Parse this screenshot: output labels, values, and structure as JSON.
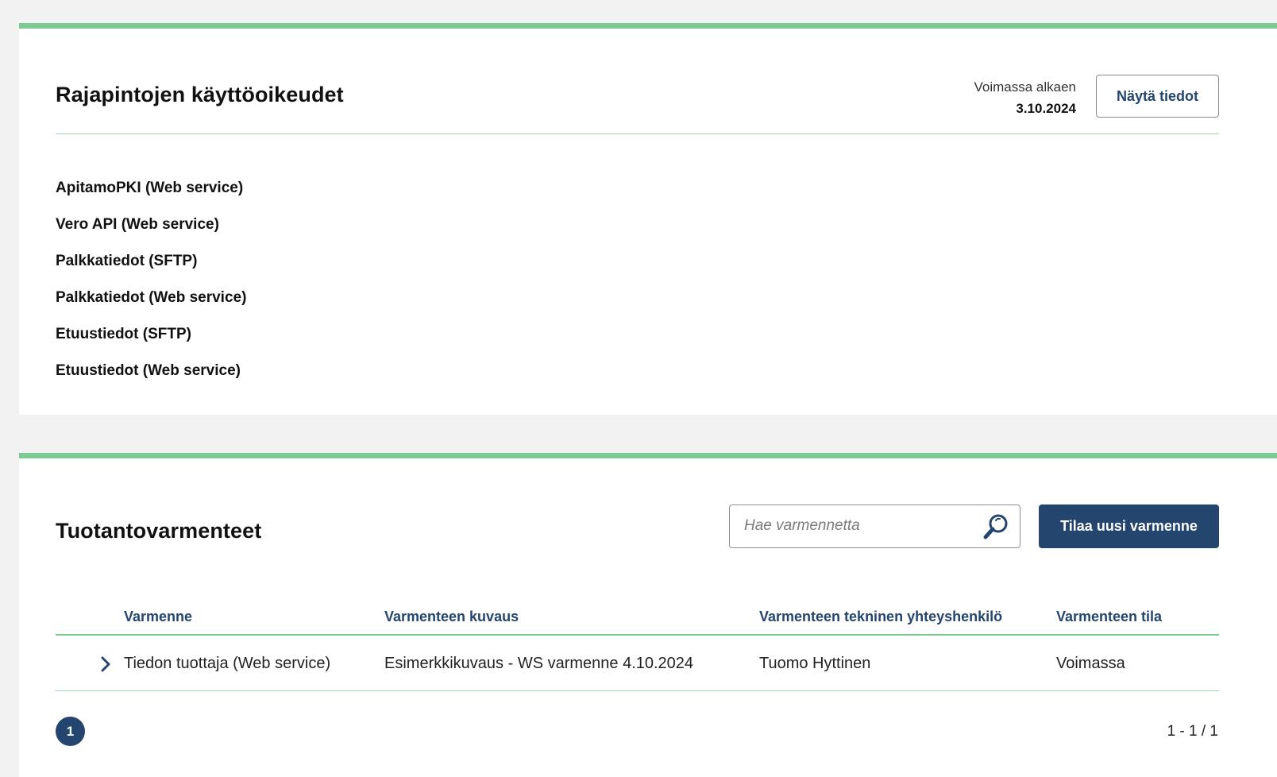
{
  "api_rights": {
    "title": "Rajapintojen käyttöoikeudet",
    "valid_from_label": "Voimassa alkaen",
    "valid_from_date": "3.10.2024",
    "show_details_label": "Näytä tiedot",
    "items": [
      "ApitamoPKI (Web service)",
      "Vero API (Web service)",
      "Palkkatiedot (SFTP)",
      "Palkkatiedot (Web service)",
      "Etuustiedot (SFTP)",
      "Etuustiedot (Web service)"
    ]
  },
  "certificates": {
    "title": "Tuotantovarmenteet",
    "search": {
      "placeholder": "Hae varmennetta",
      "value": ""
    },
    "order_button_label": "Tilaa uusi varmenne",
    "columns": [
      "Varmenne",
      "Varmenteen kuvaus",
      "Varmenteen tekninen yhteyshenkilö",
      "Varmenteen tila"
    ],
    "rows": [
      {
        "certificate": "Tiedon tuottaja (Web service)",
        "description": "Esimerkkikuvaus - WS varmenne 4.10.2024",
        "contact": "Tuomo Hyttinen",
        "status": "Voimassa"
      }
    ],
    "pagination": {
      "current_page": "1",
      "count_label": "1 - 1 / 1"
    }
  },
  "colors": {
    "accent_green": "#7cc994",
    "primary_blue": "#24456e"
  },
  "icons": {
    "search": "search-icon",
    "expand": "chevron-right-icon"
  }
}
